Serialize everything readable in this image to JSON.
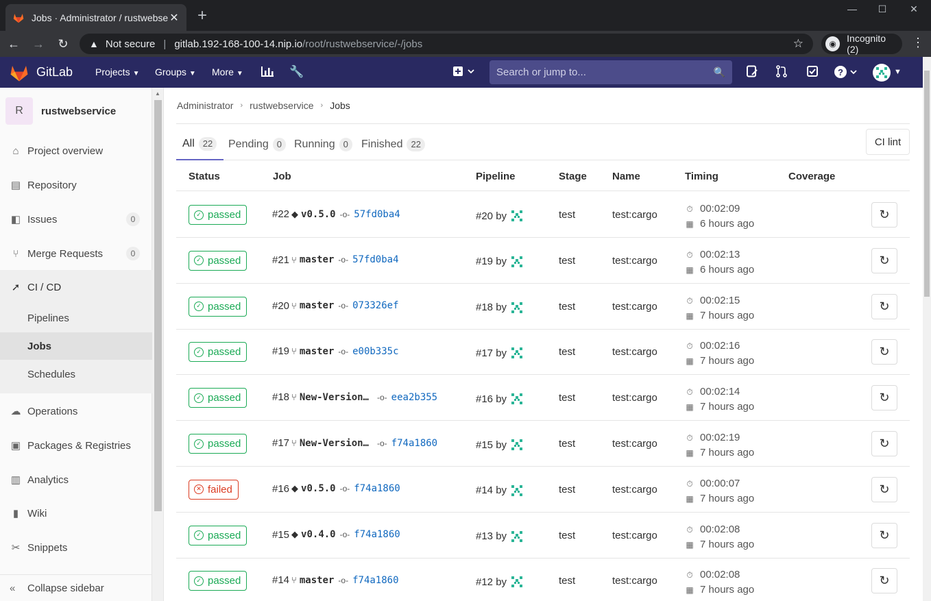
{
  "browser": {
    "tab_title": "Jobs · Administrator / rustwebser",
    "security_label": "Not secure",
    "url_host": "gitlab.192-168-100-14.nip.io",
    "url_path": "/root/rustwebservice/-/jobs",
    "incognito_label": "Incognito (2)"
  },
  "navbar": {
    "brand": "GitLab",
    "projects": "Projects",
    "groups": "Groups",
    "more": "More",
    "search_placeholder": "Search or jump to..."
  },
  "sidebar": {
    "project_letter": "R",
    "project_name": "rustwebservice",
    "items": [
      {
        "label": "Project overview",
        "icon": "home-icon"
      },
      {
        "label": "Repository",
        "icon": "doc-icon"
      },
      {
        "label": "Issues",
        "icon": "issues-icon",
        "count": "0"
      },
      {
        "label": "Merge Requests",
        "icon": "merge-request-icon",
        "count": "0"
      },
      {
        "label": "CI / CD",
        "icon": "rocket-icon"
      },
      {
        "label": "Operations",
        "icon": "cloud-gear-icon"
      },
      {
        "label": "Packages & Registries",
        "icon": "package-icon"
      },
      {
        "label": "Analytics",
        "icon": "chart-icon"
      },
      {
        "label": "Wiki",
        "icon": "book-icon"
      },
      {
        "label": "Snippets",
        "icon": "scissors-icon"
      }
    ],
    "cicd_sub": [
      "Pipelines",
      "Jobs",
      "Schedules"
    ],
    "collapse": "Collapse sidebar"
  },
  "breadcrumb": [
    "Administrator",
    "rustwebservice",
    "Jobs"
  ],
  "tabs": [
    {
      "label": "All",
      "count": "22"
    },
    {
      "label": "Pending",
      "count": "0"
    },
    {
      "label": "Running",
      "count": "0"
    },
    {
      "label": "Finished",
      "count": "22"
    }
  ],
  "ci_lint": "CI lint",
  "columns": [
    "Status",
    "Job",
    "Pipeline",
    "Stage",
    "Name",
    "Timing",
    "Coverage"
  ],
  "jobs": [
    {
      "status": "passed",
      "id": "#22",
      "ref_type": "tag",
      "ref": "v0.5.0",
      "sha": "57fd0ba4",
      "pipeline": "#20 by",
      "stage": "test",
      "name": "test:cargo",
      "duration": "00:02:09",
      "finished": "6 hours ago"
    },
    {
      "status": "passed",
      "id": "#21",
      "ref_type": "branch",
      "ref": "master",
      "sha": "57fd0ba4",
      "pipeline": "#19 by",
      "stage": "test",
      "name": "test:cargo",
      "duration": "00:02:13",
      "finished": "6 hours ago"
    },
    {
      "status": "passed",
      "id": "#20",
      "ref_type": "branch",
      "ref": "master",
      "sha": "073326ef",
      "pipeline": "#18 by",
      "stage": "test",
      "name": "test:cargo",
      "duration": "00:02:15",
      "finished": "7 hours ago"
    },
    {
      "status": "passed",
      "id": "#19",
      "ref_type": "branch",
      "ref": "master",
      "sha": "e00b335c",
      "pipeline": "#17 by",
      "stage": "test",
      "name": "test:cargo",
      "duration": "00:02:16",
      "finished": "7 hours ago"
    },
    {
      "status": "passed",
      "id": "#18",
      "ref_type": "branch",
      "ref": "New-Version…",
      "sha": "eea2b355",
      "pipeline": "#16 by",
      "stage": "test",
      "name": "test:cargo",
      "duration": "00:02:14",
      "finished": "7 hours ago"
    },
    {
      "status": "passed",
      "id": "#17",
      "ref_type": "branch",
      "ref": "New-Version…",
      "sha": "f74a1860",
      "pipeline": "#15 by",
      "stage": "test",
      "name": "test:cargo",
      "duration": "00:02:19",
      "finished": "7 hours ago"
    },
    {
      "status": "failed",
      "id": "#16",
      "ref_type": "tag",
      "ref": "v0.5.0",
      "sha": "f74a1860",
      "pipeline": "#14 by",
      "stage": "test",
      "name": "test:cargo",
      "duration": "00:00:07",
      "finished": "7 hours ago"
    },
    {
      "status": "passed",
      "id": "#15",
      "ref_type": "tag",
      "ref": "v0.4.0",
      "sha": "f74a1860",
      "pipeline": "#13 by",
      "stage": "test",
      "name": "test:cargo",
      "duration": "00:02:08",
      "finished": "7 hours ago"
    },
    {
      "status": "passed",
      "id": "#14",
      "ref_type": "branch",
      "ref": "master",
      "sha": "f74a1860",
      "pipeline": "#12 by",
      "stage": "test",
      "name": "test:cargo",
      "duration": "00:02:08",
      "finished": "7 hours ago"
    }
  ],
  "colors": {
    "navbar": "#292961",
    "passed": "#1aaa55",
    "failed": "#db3b21",
    "sha_link": "#1068bf",
    "identicon": "#2bb597"
  }
}
